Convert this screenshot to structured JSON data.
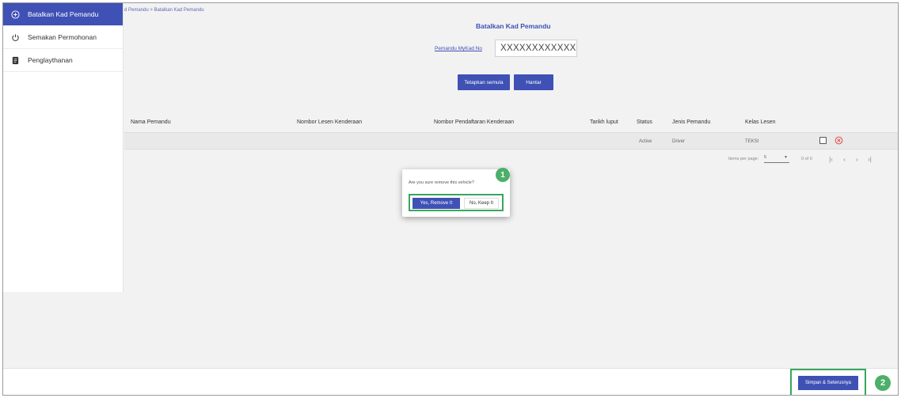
{
  "sidebar": {
    "items": [
      {
        "label": "Batalkan Kad Pemandu",
        "icon": "plus-circle-icon",
        "active": true
      },
      {
        "label": "Semakan Permohonan",
        "icon": "power-icon",
        "active": false
      },
      {
        "label": "Penglaythanan",
        "icon": "document-icon",
        "active": false
      }
    ]
  },
  "breadcrumb": "d Pemandu > Batalkan Kad Pemandu",
  "header": {
    "title": "Batalkan Kad Pemandu"
  },
  "form": {
    "mykad_label": "Pemandu MyKad No",
    "mykad_value": "XXXXXXXXXXXX",
    "reset_label": "Tetapkan semula",
    "submit_label": "Hantar"
  },
  "table": {
    "columns": [
      "Nama Pemandu",
      "Nombor Lesen Kenderaan",
      "Nombor Pendaftaran Kenderaan",
      "Tarikh luput",
      "Status",
      "Jenis Pemandu",
      "Kelas Lesen"
    ],
    "rows": [
      {
        "nama": "",
        "lesen": "",
        "pendaftaran": "",
        "tarikh": "",
        "status": "Active",
        "jenis": "Driver",
        "kelas": "TEKSI"
      }
    ]
  },
  "paginator": {
    "items_per_page_label": "Items per page:",
    "page_size": "5",
    "range": "0 of 0"
  },
  "dialog": {
    "message": "Are you sure remove this vehicle?",
    "confirm_label": "Yes, Remove It",
    "cancel_label": "No, Keep It",
    "step": "1"
  },
  "footer": {
    "save_label": "Simpan & Seterusnya",
    "step": "2"
  },
  "colors": {
    "primary": "#3f51b5",
    "highlight": "#37a85e",
    "danger": "#e53935"
  }
}
